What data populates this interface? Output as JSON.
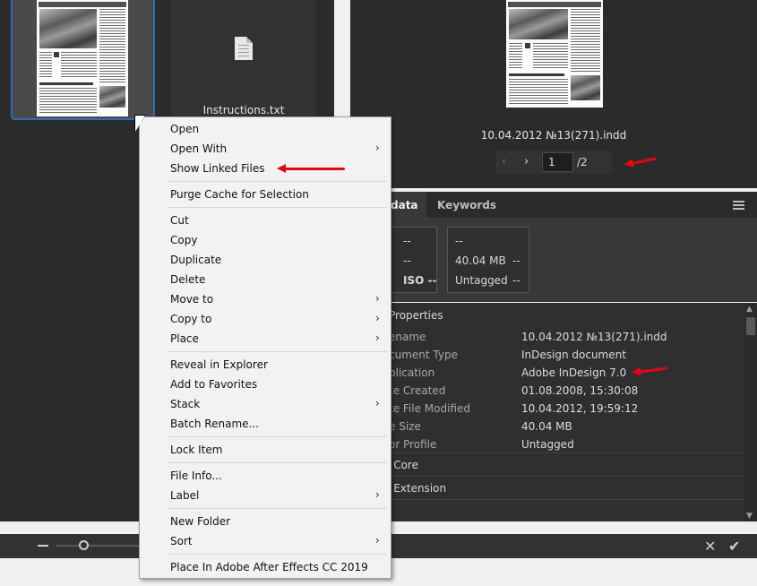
{
  "content": {
    "thumbnails": [
      {
        "name": "",
        "kind": "indd-page"
      },
      {
        "name": "Instructions.txt",
        "kind": "text-file"
      }
    ]
  },
  "preview": {
    "file_name": "10.04.2012 №13(271).indd",
    "page_current": "1",
    "page_total": "/2"
  },
  "tabs": {
    "metadata": "data",
    "keywords": "Keywords"
  },
  "camera": {
    "box1": [
      "--",
      "--",
      "ISO --"
    ],
    "box2": [
      "--",
      "40.04 MB",
      "--",
      "Untagged",
      "--"
    ]
  },
  "properties": {
    "header": "Properties",
    "rows": [
      {
        "label": "ename",
        "value": "10.04.2012 №13(271).indd"
      },
      {
        "label": "cument Type",
        "value": "InDesign document"
      },
      {
        "label": "plication",
        "value": "Adobe InDesign 7.0"
      },
      {
        "label": "te Created",
        "value": "01.08.2008, 15:30:08"
      },
      {
        "label": "te File Modified",
        "value": "10.04.2012, 19:59:12"
      },
      {
        "label": "e Size",
        "value": "40.04 MB"
      },
      {
        "label": "or Profile",
        "value": "Untagged"
      }
    ],
    "sections": [
      "C Core",
      "C Extension",
      "s"
    ]
  },
  "context_menu": {
    "items": [
      {
        "label": "Open"
      },
      {
        "label": "Open With",
        "submenu": true
      },
      {
        "label": "Show Linked Files"
      },
      {
        "label": "Purge Cache for Selection"
      },
      {
        "label": "Cut"
      },
      {
        "label": "Copy"
      },
      {
        "label": "Duplicate"
      },
      {
        "label": "Delete"
      },
      {
        "label": "Move to",
        "submenu": true
      },
      {
        "label": "Copy to",
        "submenu": true
      },
      {
        "label": "Place",
        "submenu": true
      },
      {
        "label": "Reveal in Explorer"
      },
      {
        "label": "Add to Favorites"
      },
      {
        "label": "Stack",
        "submenu": true
      },
      {
        "label": "Batch Rename..."
      },
      {
        "label": "Lock Item"
      },
      {
        "label": "File Info..."
      },
      {
        "label": "Label",
        "submenu": true
      },
      {
        "label": "New Folder"
      },
      {
        "label": "Sort",
        "submenu": true
      },
      {
        "label": "Place In Adobe After Effects CC 2019"
      }
    ],
    "submenu_glyph": "›"
  },
  "icons": {
    "prev": "‹",
    "next": "›",
    "cancel": "✕",
    "confirm": "✔",
    "scroll_up": "▲",
    "scroll_down": "▼"
  },
  "colors": {
    "selection_border": "#2e6db4",
    "annotation_arrow": "#e30613",
    "panel_bg": "#2b2b2b",
    "menu_bg": "#f2f2f2"
  }
}
